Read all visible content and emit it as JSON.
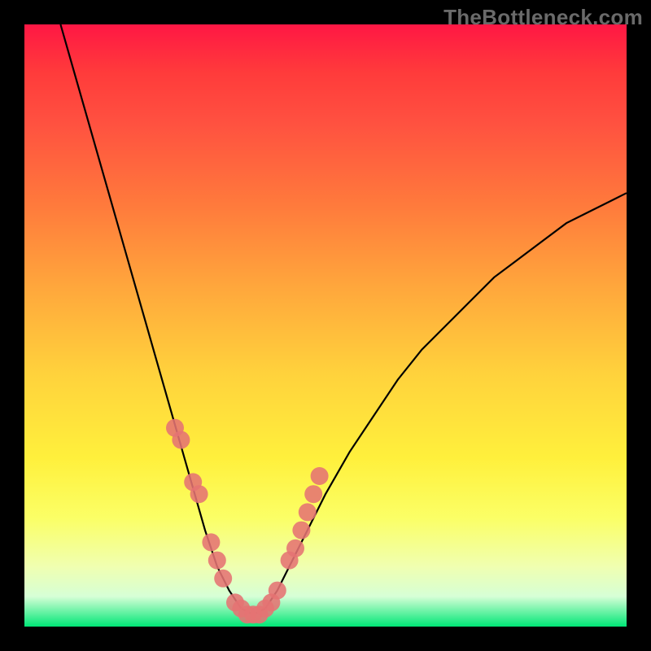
{
  "watermark": "TheBottleneck.com",
  "colors": {
    "background": "#000000",
    "gradient_top": "#ff1744",
    "gradient_mid": "#ffe23c",
    "gradient_bottom": "#00e676",
    "curve": "#000000",
    "marker": "#e57373"
  },
  "chart_data": {
    "type": "line",
    "title": "",
    "xlabel": "",
    "ylabel": "",
    "xlim": [
      0,
      100
    ],
    "ylim": [
      0,
      100
    ],
    "grid": false,
    "legend": false,
    "series": [
      {
        "name": "curve",
        "x": [
          6,
          8,
          10,
          12,
          14,
          16,
          18,
          20,
          22,
          24,
          26,
          28,
          30,
          32,
          34,
          36,
          38,
          40,
          42,
          44,
          46,
          50,
          54,
          58,
          62,
          66,
          70,
          74,
          78,
          82,
          86,
          90,
          94,
          98,
          100
        ],
        "y": [
          100,
          93,
          86,
          79,
          72,
          65,
          58,
          51,
          44,
          37,
          30,
          23,
          16,
          10,
          6,
          3,
          2,
          3,
          6,
          10,
          14,
          22,
          29,
          35,
          41,
          46,
          50,
          54,
          58,
          61,
          64,
          67,
          69,
          71,
          72
        ]
      }
    ],
    "markers": {
      "name": "highlight-points",
      "x": [
        25,
        26,
        28,
        29,
        31,
        32,
        33,
        35,
        36,
        37,
        38,
        39,
        40,
        41,
        42,
        44,
        45,
        46,
        47,
        48,
        49
      ],
      "y": [
        33,
        31,
        24,
        22,
        14,
        11,
        8,
        4,
        3,
        2,
        2,
        2,
        3,
        4,
        6,
        11,
        13,
        16,
        19,
        22,
        25
      ]
    }
  }
}
